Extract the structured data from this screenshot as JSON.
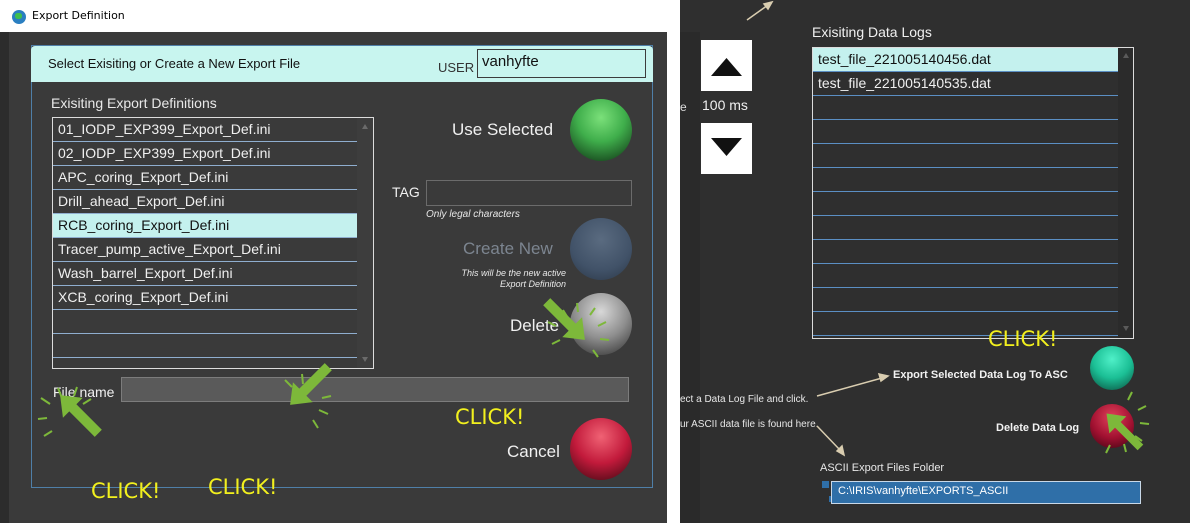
{
  "window": {
    "title": "Export Definition"
  },
  "header": {
    "prompt": "Select Exisiting or Create a New Export File",
    "user_label": "USER",
    "user_value": "vanhyfte"
  },
  "definitions": {
    "title": "Exisiting Export Definitions",
    "items": [
      "01_IODP_EXP399_Export_Def.ini",
      "02_IODP_EXP399_Export_Def.ini",
      "APC_coring_Export_Def.ini",
      "Drill_ahead_Export_Def.ini",
      "RCB_coring_Export_Def.ini",
      "Tracer_pump_active_Export_Def.ini",
      "Wash_barrel_Export_Def.ini",
      "XCB_coring_Export_Def.ini",
      "",
      "",
      ""
    ],
    "selected_index": 4
  },
  "actions": {
    "use_selected": "Use Selected",
    "tag_label": "TAG",
    "tag_hint": "Only legal characters",
    "create_new": "Create New",
    "create_hint_line1": "This will be the new active",
    "create_hint_line2": "Export Definition",
    "delete": "Delete",
    "cancel": "Cancel",
    "file_name_label": "File name"
  },
  "annotations": {
    "click": "CLICK!"
  },
  "colors": {
    "green": "#3fae4b",
    "red": "#c21a3b",
    "selection": "#c4f1ee",
    "annotation": "#f2f01e",
    "arrow": "#7db83a"
  },
  "right": {
    "interval": "100 ms",
    "edge_text": "e",
    "logs_title": "Exisiting Data Logs",
    "logs": [
      "test_file_221005140456.dat",
      "test_file_221005140535.dat",
      "",
      "",
      "",
      "",
      "",
      "",
      "",
      "",
      "",
      ""
    ],
    "selected_index": 0,
    "hint_select": "ect  a Data Log File and click.",
    "hint_found": "ur ASCII data file is found here.",
    "export_label": "Export Selected Data Log To ASC",
    "delete_label": "Delete Data Log",
    "folder_label": "ASCII Export Files Folder",
    "folder_path": "C:\\IRIS\\vanhyfte\\EXPORTS_ASCII",
    "up_icon": "triangle-up",
    "down_icon": "triangle-down"
  }
}
